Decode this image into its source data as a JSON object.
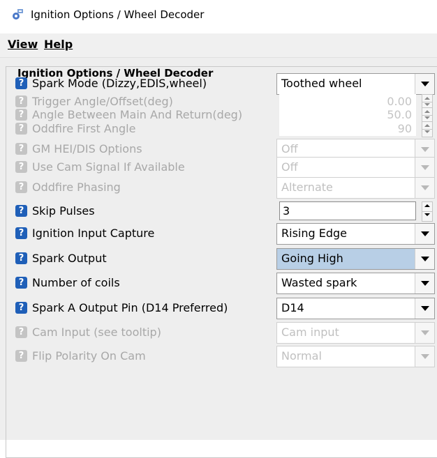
{
  "window": {
    "title": "Ignition Options / Wheel Decoder"
  },
  "menu": [
    "View",
    "Help"
  ],
  "group": {
    "title": "Ignition Options / Wheel Decoder"
  },
  "rows": [
    {
      "label": "Spark Mode (Dizzy,EDIS,wheel)",
      "value": "Toothed wheel",
      "enabled": true,
      "control": "combo"
    },
    {
      "label": "Trigger Angle/Offset(deg)",
      "value": "0.00",
      "enabled": false,
      "control": "spinner"
    },
    {
      "label": "Angle Between Main And Return(deg)",
      "value": "50.0",
      "enabled": false,
      "control": "spinner"
    },
    {
      "label": "Oddfire First Angle",
      "value": "90",
      "enabled": false,
      "control": "spinner"
    },
    {
      "label": "GM HEI/DIS Options",
      "value": "Off",
      "enabled": false,
      "control": "combo"
    },
    {
      "label": "Use Cam Signal If Available",
      "value": "Off",
      "enabled": false,
      "control": "combo"
    },
    {
      "label": "Oddfire Phasing",
      "value": "Alternate",
      "enabled": false,
      "control": "combo"
    },
    {
      "label": "Skip Pulses",
      "value": "3",
      "enabled": true,
      "control": "spinner"
    },
    {
      "label": "Ignition Input Capture",
      "value": "Rising Edge",
      "enabled": true,
      "control": "combo"
    },
    {
      "label": "Spark Output",
      "value": "Going High",
      "enabled": true,
      "control": "combo",
      "highlighted": true
    },
    {
      "label": "Number of coils",
      "value": "Wasted spark",
      "enabled": true,
      "control": "combo"
    },
    {
      "label": "Spark A Output Pin (D14 Preferred)",
      "value": "D14",
      "enabled": true,
      "control": "combo"
    },
    {
      "label": "Cam Input (see tooltip)",
      "value": "Cam input",
      "enabled": false,
      "control": "combo"
    },
    {
      "label": "Flip Polarity On Cam",
      "value": "Normal",
      "enabled": false,
      "control": "combo"
    }
  ],
  "help_glyph": "?",
  "icons": {
    "app": "app-gear-icon",
    "help": "help-icon",
    "arrow": "chevron-down-icon"
  },
  "colors": {
    "help_enabled": "#1f5fb8",
    "help_disabled": "#c4c4c4",
    "highlight": "#b8cfe6"
  }
}
